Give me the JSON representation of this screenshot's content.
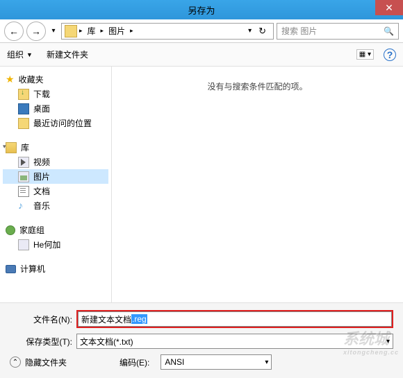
{
  "title": "另存为",
  "nav": {
    "back_icon": "←",
    "fwd_icon": "→",
    "down_icon": "▾",
    "breadcrumb": {
      "seg1": "库",
      "seg2": "图片"
    },
    "caret": "▸",
    "addr_drop": "▾",
    "refresh_icon": "↻",
    "search_placeholder": "搜索 图片",
    "search_icon": "🔍"
  },
  "toolbar": {
    "organize": "组织",
    "new_folder": "新建文件夹",
    "help_icon": "?"
  },
  "sidebar": {
    "favorites": {
      "label": "收藏夹",
      "items": [
        {
          "label": "下载"
        },
        {
          "label": "桌面"
        },
        {
          "label": "最近访问的位置"
        }
      ]
    },
    "libraries": {
      "label": "库",
      "items": [
        {
          "label": "视频"
        },
        {
          "label": "图片",
          "selected": true
        },
        {
          "label": "文档"
        },
        {
          "label": "音乐"
        }
      ]
    },
    "homegroup": {
      "label": "家庭组",
      "items": [
        {
          "label": "He何加"
        }
      ]
    },
    "computer": {
      "label": "计算机"
    }
  },
  "content": {
    "empty_msg": "没有与搜索条件匹配的项。"
  },
  "bottom": {
    "filename_label": "文件名(N):",
    "filename_text": "新建文本文档",
    "filename_selected_ext": ".reg",
    "filetype_label": "保存类型(T):",
    "filetype_value": "文本文档(*.txt)",
    "hide_folders": "隐藏文件夹",
    "encoding_label": "编码(E):",
    "encoding_value": "ANSI",
    "expand_icon": "⌃"
  },
  "watermark": {
    "brand": "系统城",
    "url": "xitongcheng.cc"
  }
}
